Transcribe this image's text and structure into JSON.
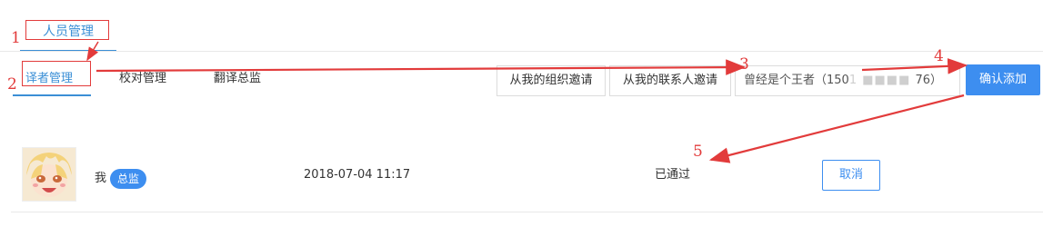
{
  "tabs": {
    "top": {
      "label": "人员管理"
    },
    "sub": [
      {
        "label": "译者管理"
      },
      {
        "label": "校对管理"
      },
      {
        "label": "翻译总监"
      }
    ]
  },
  "actions": {
    "invite_org_label": "从我的组织邀请",
    "invite_contact_label": "从我的联系人邀请",
    "search_value_prefix": "曾经是个王者（150",
    "search_value_masked": "1 ■■■■ ",
    "search_value_suffix": "76）",
    "confirm_label": "确认添加"
  },
  "members": [
    {
      "name": "我",
      "role_badge": "总监",
      "date": "2018-07-04 11:17",
      "status": "已通过",
      "action_label": "取消"
    }
  ],
  "annotations": {
    "step1": "1",
    "step2": "2",
    "step3": "3",
    "step4": "4",
    "step5": "5"
  },
  "colors": {
    "accent": "#3d8ef0",
    "tab_accent": "#3b8fd6",
    "annotation": "#e23b3b"
  }
}
